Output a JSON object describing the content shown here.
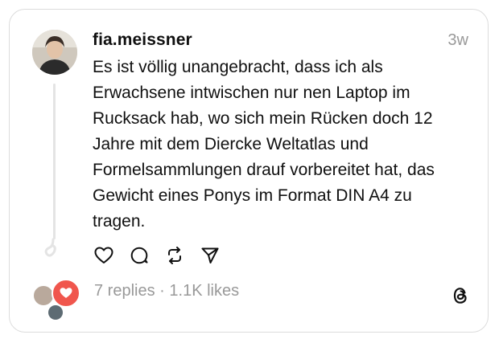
{
  "post": {
    "username": "fia.meissner",
    "time_ago": "3w",
    "text": "Es ist völlig unangebracht, dass ich als\nErwachsene intwischen nur nen Laptop im\nRucksack hab, wo sich mein Rücken doch 12\nJahre mit dem Diercke Weltatlas und\nFormelsammlungen drauf vorbereitet hat, das\nGewicht eines Ponys im Format DIN A4 zu\ntragen."
  },
  "stats": {
    "replies": "7 replies",
    "separator": " · ",
    "likes": "1.1K likes"
  },
  "icons": {
    "like": "heart-icon",
    "reply": "comment-icon",
    "repost": "repost-icon",
    "share": "send-icon",
    "brand": "threads-logo-icon"
  },
  "colors": {
    "text": "#101010",
    "muted": "#999999",
    "border": "#dcdcdc",
    "reply_badge": "#f0564d"
  }
}
